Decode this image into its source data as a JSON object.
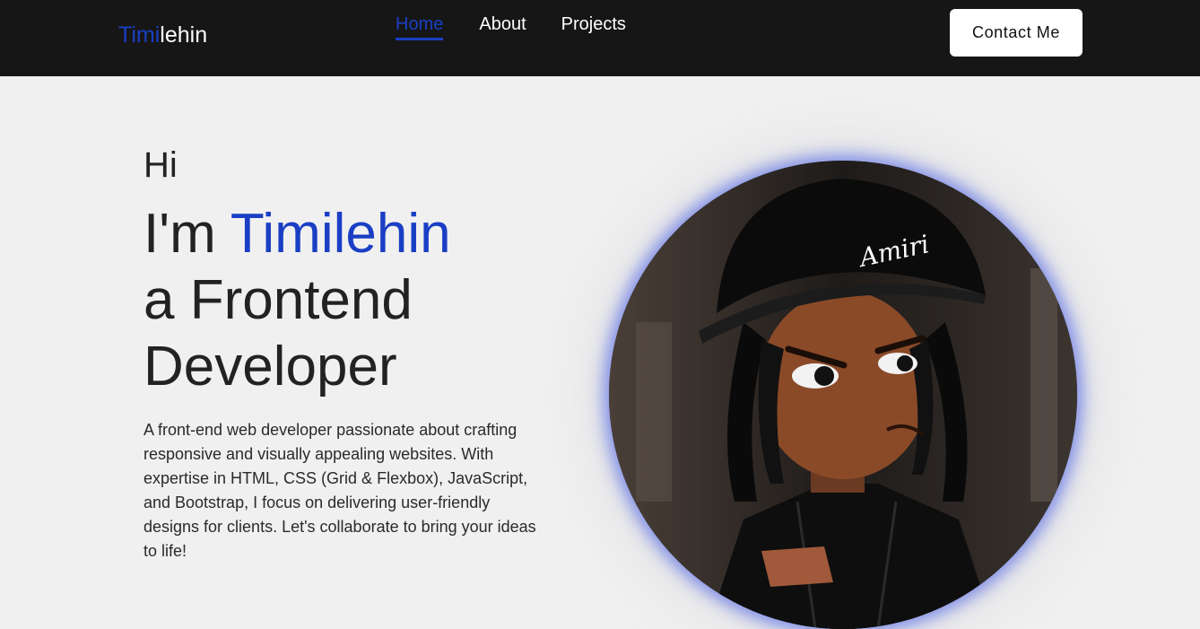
{
  "navbar": {
    "logo_accent": "Timi",
    "logo_rest": "lehin",
    "links": [
      {
        "label": "Home",
        "active": true
      },
      {
        "label": "About"
      },
      {
        "label": "Projects"
      }
    ],
    "contact_button": "Contact Me"
  },
  "hero": {
    "greeting": "Hi",
    "line1_prefix": "I'm ",
    "name": "Timilehin",
    "line2": "a Frontend",
    "line3": "Developer",
    "bio": "A front-end web developer passionate about crafting responsive and visually appealing websites. With expertise in HTML, CSS (Grid & Flexbox), JavaScript, and Bootstrap, I focus on delivering user-friendly designs for clients. Let's collaborate to bring your ideas to life!"
  },
  "avatar": {
    "cap_text": "Amiri"
  },
  "colors": {
    "accent": "#1a3fc4",
    "navbar_bg": "#161616",
    "page_bg": "#f0f0f0"
  }
}
